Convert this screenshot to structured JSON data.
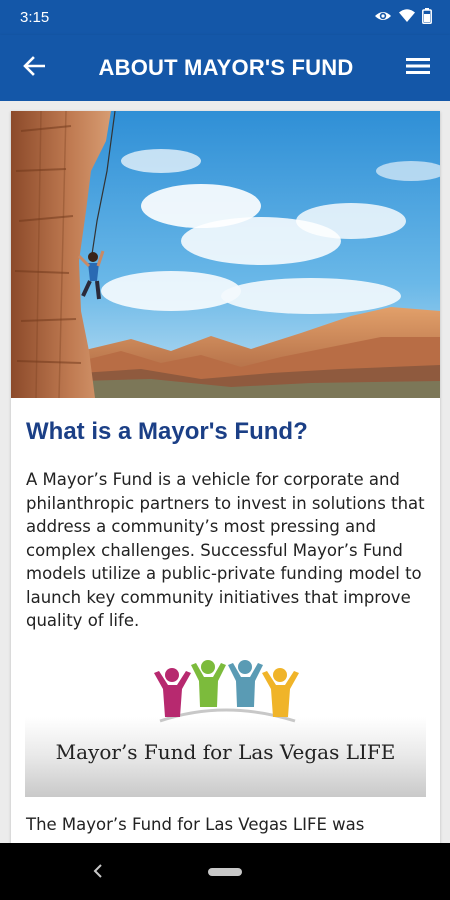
{
  "status_bar": {
    "time": "3:15",
    "icons": [
      "eye-icon",
      "wifi-icon",
      "battery-icon"
    ]
  },
  "app_bar": {
    "title": "ABOUT MAYOR'S FUND",
    "back_icon": "arrow-left-icon",
    "menu_icon": "hamburger-menu-icon",
    "background_color": "#1457a8"
  },
  "article": {
    "heading": "What is a Mayor's Fund?",
    "paragraph_1": "A Mayor’s Fund is a vehicle for corporate and philanthropic partners to invest in solutions that address a community’s most pressing and complex challenges. Successful Mayor’s Fund models utilize a public-private funding model to launch key community initiatives that improve quality of life.",
    "logo_text": "Mayor’s Fund for Las Vegas LIFE",
    "paragraph_2": "The Mayor’s Fund for Las Vegas LIFE was",
    "heading_color": "#1b3f86"
  },
  "logo": {
    "figure_colors": [
      "#b7296f",
      "#7cbb3c",
      "#5a9bb4",
      "#f0b429"
    ]
  },
  "nav_bar": {
    "back_icon": "nav-back-icon",
    "home_icon": "nav-home-pill-icon"
  }
}
